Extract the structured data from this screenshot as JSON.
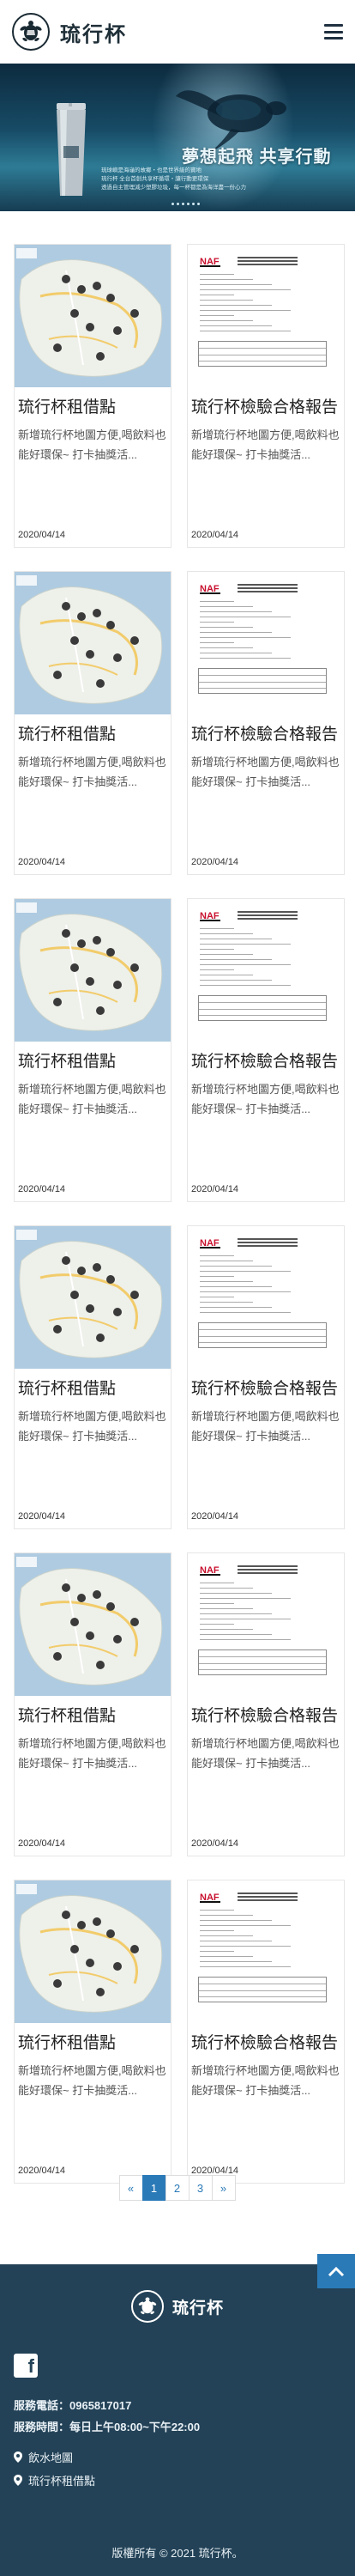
{
  "header": {
    "brand": "琉行杯",
    "logo_icon": "turtle-logo-icon",
    "menu_icon": "hamburger-menu-icon"
  },
  "banner": {
    "headline": "夢想起飛 共享行動",
    "lines": [
      "琉球嶼是海龜的故鄉・也是世界級的寶地",
      "琉行杯 全台首創共享杯循環・讓行動更環保",
      "透過自主管理減少塑膠垃圾，每一杯都是為海洋盡一份心力"
    ]
  },
  "cards": [
    {
      "type": "map",
      "title": "琉行杯租借點",
      "desc": "新增琉行杯地圖方便,喝飲料也能好環保~ 打卡抽獎活...",
      "date": "2020/04/14"
    },
    {
      "type": "doc",
      "title": "琉行杯檢驗合格報告",
      "desc": "新增琉行杯地圖方便,喝飲料也能好環保~ 打卡抽獎活...",
      "date": "2020/04/14"
    },
    {
      "type": "map",
      "title": "琉行杯租借點",
      "desc": "新增琉行杯地圖方便,喝飲料也能好環保~ 打卡抽獎活...",
      "date": "2020/04/14"
    },
    {
      "type": "doc",
      "title": "琉行杯檢驗合格報告",
      "desc": "新增琉行杯地圖方便,喝飲料也能好環保~ 打卡抽獎活...",
      "date": "2020/04/14"
    },
    {
      "type": "map",
      "title": "琉行杯租借點",
      "desc": "新增琉行杯地圖方便,喝飲料也能好環保~ 打卡抽獎活...",
      "date": "2020/04/14"
    },
    {
      "type": "doc",
      "title": "琉行杯檢驗合格報告",
      "desc": "新增琉行杯地圖方便,喝飲料也能好環保~ 打卡抽獎活...",
      "date": "2020/04/14"
    },
    {
      "type": "map",
      "title": "琉行杯租借點",
      "desc": "新增琉行杯地圖方便,喝飲料也能好環保~ 打卡抽獎活...",
      "date": "2020/04/14"
    },
    {
      "type": "doc",
      "title": "琉行杯檢驗合格報告",
      "desc": "新增琉行杯地圖方便,喝飲料也能好環保~ 打卡抽獎活...",
      "date": "2020/04/14"
    },
    {
      "type": "map",
      "title": "琉行杯租借點",
      "desc": "新增琉行杯地圖方便,喝飲料也能好環保~ 打卡抽獎活...",
      "date": "2020/04/14"
    },
    {
      "type": "doc",
      "title": "琉行杯檢驗合格報告",
      "desc": "新增琉行杯地圖方便,喝飲料也能好環保~ 打卡抽獎活...",
      "date": "2020/04/14"
    },
    {
      "type": "map",
      "title": "琉行杯租借點",
      "desc": "新增琉行杯地圖方便,喝飲料也能好環保~ 打卡抽獎活...",
      "date": "2020/04/14"
    },
    {
      "type": "doc",
      "title": "琉行杯檢驗合格報告",
      "desc": "新增琉行杯地圖方便,喝飲料也能好環保~ 打卡抽獎活...",
      "date": "2020/04/14"
    }
  ],
  "pagination": {
    "prev": "«",
    "pages": [
      "1",
      "2",
      "3"
    ],
    "current": "1",
    "next": "»"
  },
  "back_to_top_icon": "chevron-up-icon",
  "footer": {
    "brand": "琉行杯",
    "facebook_icon": "facebook-icon",
    "phone": "服務電話：0965817017",
    "hours": "服務時間：每日上午08:00~下午22:00",
    "links": [
      "飲水地圖",
      "琉行杯租借點"
    ],
    "link_icon": "map-pin-icon",
    "copyright": "版權所有 © 2021 琉行杯。"
  },
  "colors": {
    "accent": "#2a7ab8",
    "footer_bg": "#234257",
    "banner_deep": "#0d2b3f"
  }
}
